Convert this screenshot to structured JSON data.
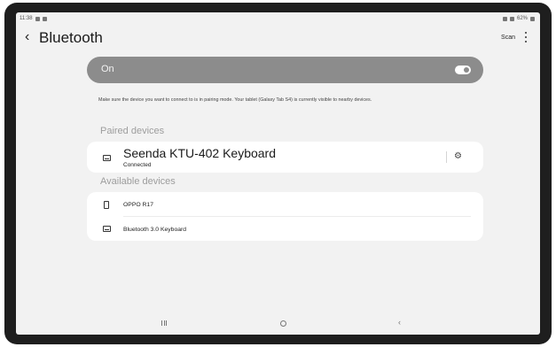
{
  "status_bar": {
    "time": "11:38",
    "battery": "62%"
  },
  "header": {
    "back_icon": "chevron-left-icon",
    "title": "Bluetooth",
    "scan_label": "Scan",
    "more_icon": "more-vertical-icon"
  },
  "toggle": {
    "label": "On",
    "state": "on"
  },
  "info_text": "Make sure the device you want to connect to is in pairing mode. Your tablet (Galaxy Tab S4) is currently visible to nearby devices.",
  "paired": {
    "header": "Paired devices",
    "devices": [
      {
        "name": "Seenda KTU-402 Keyboard",
        "status": "Connected",
        "icon": "keyboard-icon",
        "settings_icon": "gear-icon"
      }
    ]
  },
  "available": {
    "header": "Available devices",
    "devices": [
      {
        "name": "OPPO R17",
        "icon": "phone-icon"
      },
      {
        "name": "Bluetooth 3.0 Keyboard",
        "icon": "keyboard-icon"
      }
    ]
  },
  "nav_bar": {
    "recents_icon": "recents-icon",
    "home_icon": "home-icon",
    "back_icon": "back-icon"
  },
  "colors": {
    "toggle_bg": "#8c8c8c",
    "screen_bg": "#f2f2f2",
    "card_bg": "#ffffff",
    "bezel": "#1e1e1e"
  }
}
